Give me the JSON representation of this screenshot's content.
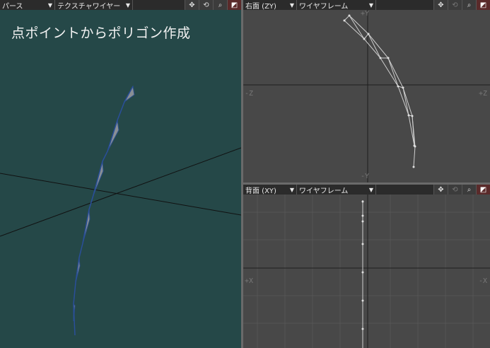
{
  "perspective": {
    "view_label": "パース",
    "shading_label": "テクスチャワイヤー",
    "caption": "点ポイントからポリゴン作成",
    "background": "#254848"
  },
  "right_view": {
    "view_label": "右面 (ZY)",
    "shading_label": "ワイヤフレーム",
    "axis_left": "-Z",
    "axis_right": "+Z",
    "axis_top": "+Y",
    "axis_bottom": "-Y"
  },
  "back_view": {
    "view_label": "背面 (XY)",
    "shading_label": "ワイヤフレーム",
    "axis_left": "+X",
    "axis_right": "-X"
  },
  "icons": {
    "move": "move-icon",
    "rotate": "rotate-icon",
    "zoom": "zoom-icon",
    "maximize": "maximize-icon"
  },
  "colors": {
    "ortho_background": "#484848",
    "grid": "#555555",
    "axis": "#222222",
    "wire": "#cfcfcf"
  }
}
